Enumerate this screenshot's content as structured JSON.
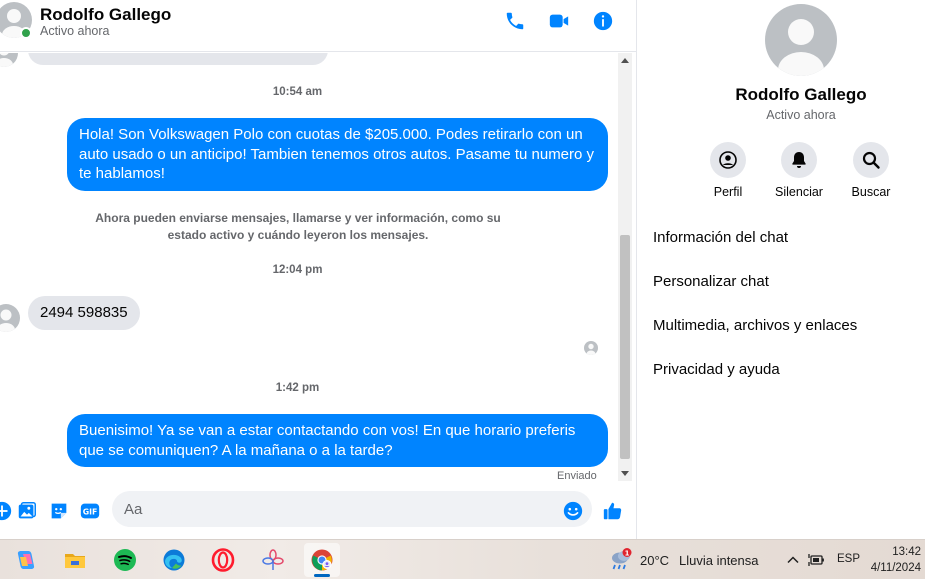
{
  "header": {
    "name": "Rodolfo Gallego",
    "status": "Activo ahora"
  },
  "messages": {
    "time_1": "10:54 am",
    "msg_out_1": "Hola! Son Volkswagen Polo con cuotas de $205.000. Podes retirarlo con un auto usado o un anticipo! Tambien tenemos otros autos. Pasame tu numero y te hablamos!",
    "system_note": "Ahora pueden enviarse mensajes, llamarse y ver información, como su estado activo y cuándo leyeron los mensajes.",
    "time_2": "12:04 pm",
    "msg_in_1": "2494 598835",
    "time_3": "1:42 pm",
    "msg_out_2": "Buenisimo! Ya se van a estar contactando con vos! En que horario preferis que se comuniquen? A la mañana o a la tarde?",
    "sent_label": "Enviado"
  },
  "composer": {
    "placeholder": "Aa"
  },
  "right_panel": {
    "name": "Rodolfo Gallego",
    "status": "Activo ahora",
    "actions": [
      {
        "label": "Perfil",
        "icon": "profile-icon"
      },
      {
        "label": "Silenciar",
        "icon": "bell-icon"
      },
      {
        "label": "Buscar",
        "icon": "search-icon"
      }
    ],
    "menu": [
      {
        "label": "Información del chat"
      },
      {
        "label": "Personalizar chat"
      },
      {
        "label": "Multimedia, archivos y enlaces"
      },
      {
        "label": "Privacidad y ayuda"
      }
    ]
  },
  "taskbar": {
    "weather_badge": "1",
    "weather_temp": "20°C",
    "weather_desc": "Lluvia intensa",
    "language": "ESP",
    "time": "13:42",
    "date": "4/11/2024"
  },
  "colors": {
    "accent": "#0084ff",
    "online": "#31a24c",
    "incoming_bubble": "#e4e6eb"
  }
}
